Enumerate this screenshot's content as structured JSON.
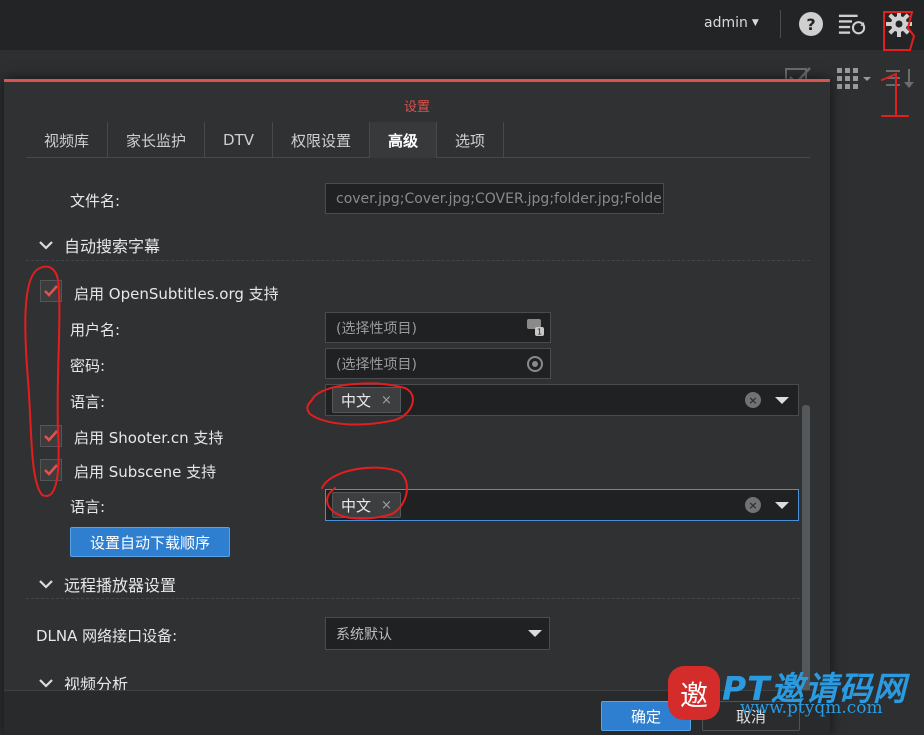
{
  "topbar": {
    "user_label": "admin",
    "icons": [
      "help-icon",
      "activity-icon",
      "settings-gear-icon"
    ]
  },
  "dialog": {
    "title": "设置",
    "tabs": [
      {
        "label": "视频库",
        "active": false
      },
      {
        "label": "家长监护",
        "active": false
      },
      {
        "label": "DTV",
        "active": false
      },
      {
        "label": "权限设置",
        "active": false
      },
      {
        "label": "高级",
        "active": true
      },
      {
        "label": "选项",
        "active": false
      }
    ],
    "filename_row": {
      "label": "文件名:",
      "value": "cover.jpg;Cover.jpg;COVER.jpg;folder.jpg;Folde"
    },
    "auto_subtitle": {
      "header": "自动搜索字幕",
      "opensubtitles": {
        "label": "启用 OpenSubtitles.org 支持",
        "checked": true
      },
      "username": {
        "label": "用户名:",
        "placeholder": "(选择性项目)"
      },
      "password": {
        "label": "密码:",
        "placeholder": "(选择性项目)"
      },
      "language1": {
        "label": "语言:",
        "tag": "中文",
        "tag_remove": "×"
      },
      "shooter": {
        "label": "启用 Shooter.cn 支持",
        "checked": true
      },
      "subscene": {
        "label": "启用 Subscene 支持",
        "checked": true
      },
      "language2": {
        "label": "语言:",
        "tag": "中文",
        "tag_remove": "×"
      },
      "order_button": "设置自动下载顺序"
    },
    "remote_player": {
      "header": "远程播放器设置"
    },
    "dlna": {
      "label": "DLNA 网络接口设备:",
      "value": "系统默认"
    },
    "video_analysis": {
      "header": "视频分析"
    },
    "buttons": {
      "ok": "确定",
      "cancel": "取消"
    }
  },
  "annotations": {
    "marker": "1"
  },
  "watermark": {
    "brand": "PT邀请码网",
    "url": "www.ptyqm.com",
    "logo_char": "邀"
  },
  "colors": {
    "accent_red": "#e2514b",
    "primary_blue": "#2f7fd0",
    "annotation_red": "#e41e1e",
    "watermark_blue": "#2a9be0"
  }
}
